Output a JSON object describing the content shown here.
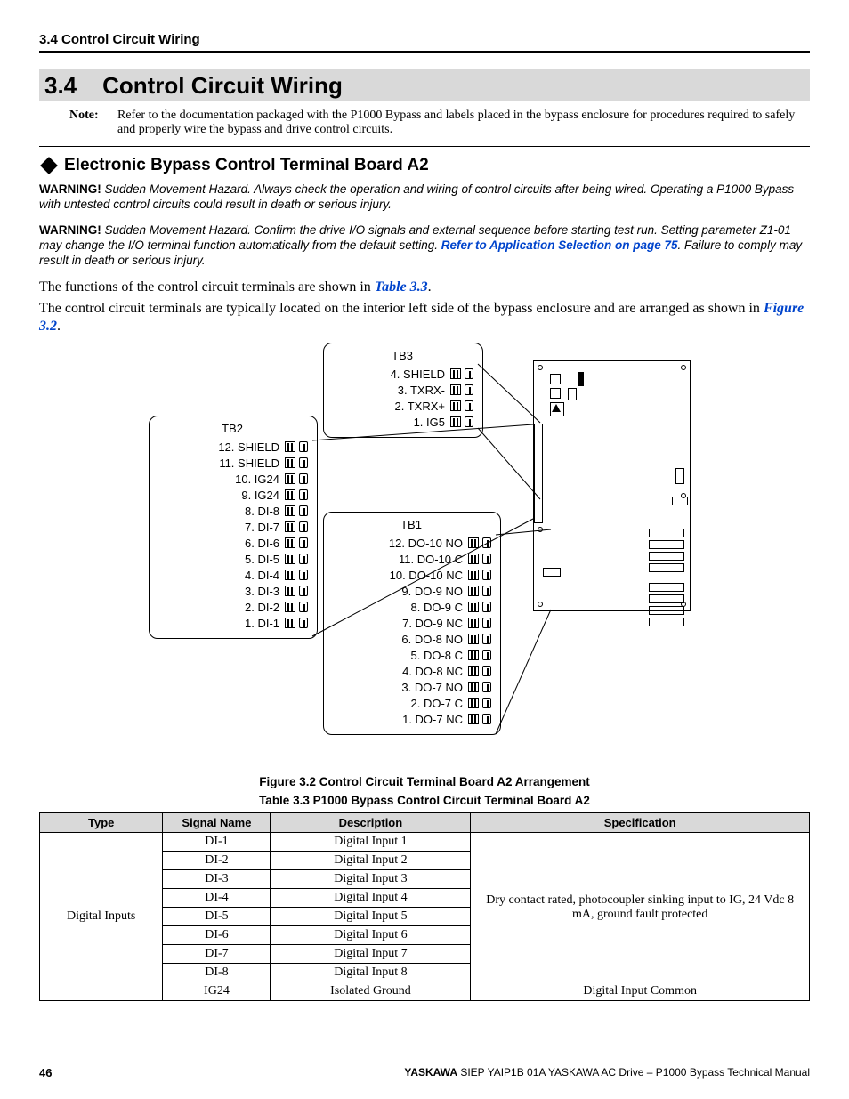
{
  "header": {
    "running": "3.4 Control Circuit Wiring"
  },
  "section": {
    "num": "3.4",
    "title": "Control Circuit Wiring"
  },
  "note": {
    "label": "Note:",
    "text": "Refer to the documentation packaged with the P1000 Bypass and labels placed in the bypass enclosure for procedures required to safely and properly wire the bypass and drive control circuits."
  },
  "subhead": "Electronic Bypass Control Terminal Board A2",
  "warnings": [
    {
      "label": "WARNING!",
      "pre": "Sudden Movement Hazard. Always check the operation and wiring of control circuits after being wired. Operating a P1000 Bypass with untested control circuits could result in death or serious injury.",
      "link": "",
      "post": ""
    },
    {
      "label": "WARNING!",
      "pre": "Sudden Movement Hazard. Confirm the drive I/O signals and external sequence before starting test run. Setting parameter Z1-01 may change the I/O terminal function automatically from the default setting. ",
      "link": "Refer to Application Selection on page 75",
      "post": ". Failure to comply may result in death or serious injury."
    }
  ],
  "body": {
    "p1a": "The functions of the control circuit terminals are shown in ",
    "p1link": "Table 3.3",
    "p1b": ".",
    "p2a": "The control circuit terminals are typically located on the interior left side of the bypass enclosure and are arranged as shown in ",
    "p2link": "Figure 3.2",
    "p2b": "."
  },
  "figure": {
    "caption": "Figure 3.2  Control Circuit Terminal Board A2 Arrangement",
    "tb3": {
      "title": "TB3",
      "rows": [
        "4. SHIELD",
        "3. TXRX-",
        "2. TXRX+",
        "1. IG5"
      ]
    },
    "tb2": {
      "title": "TB2",
      "rows": [
        "12. SHIELD",
        "11. SHIELD",
        "10. IG24",
        "9. IG24",
        "8. DI-8",
        "7. DI-7",
        "6. DI-6",
        "5. DI-5",
        "4. DI-4",
        "3. DI-3",
        "2. DI-2",
        "1. DI-1"
      ]
    },
    "tb1": {
      "title": "TB1",
      "rows": [
        "12. DO-10 NO",
        "11. DO-10 C",
        "10. DO-10 NC",
        "9. DO-9 NO",
        "8. DO-9 C",
        "7. DO-9 NC",
        "6. DO-8 NO",
        "5. DO-8 C",
        "4. DO-8 NC",
        "3. DO-7 NO",
        "2. DO-7 C",
        "1. DO-7 NC"
      ]
    }
  },
  "table": {
    "caption": "Table 3.3  P1000 Bypass Control Circuit Terminal Board A2",
    "headers": [
      "Type",
      "Signal Name",
      "Description",
      "Specification"
    ],
    "typeLabel": "Digital Inputs",
    "spec8": "Dry contact rated, photocoupler sinking input to IG, 24 Vdc 8 mA, ground fault protected",
    "rows": [
      {
        "sig": "DI-1",
        "desc": "Digital Input 1"
      },
      {
        "sig": "DI-2",
        "desc": "Digital Input 2"
      },
      {
        "sig": "DI-3",
        "desc": "Digital Input 3"
      },
      {
        "sig": "DI-4",
        "desc": "Digital Input 4"
      },
      {
        "sig": "DI-5",
        "desc": "Digital Input 5"
      },
      {
        "sig": "DI-6",
        "desc": "Digital Input 6"
      },
      {
        "sig": "DI-7",
        "desc": "Digital Input 7"
      },
      {
        "sig": "DI-8",
        "desc": "Digital Input 8"
      }
    ],
    "lastRow": {
      "sig": "IG24",
      "desc": "Isolated Ground",
      "spec": "Digital Input Common"
    }
  },
  "footer": {
    "page": "46",
    "brand": "YASKAWA",
    "rest": " SIEP YAIP1B 01A YASKAWA AC Drive – P1000 Bypass Technical Manual"
  }
}
